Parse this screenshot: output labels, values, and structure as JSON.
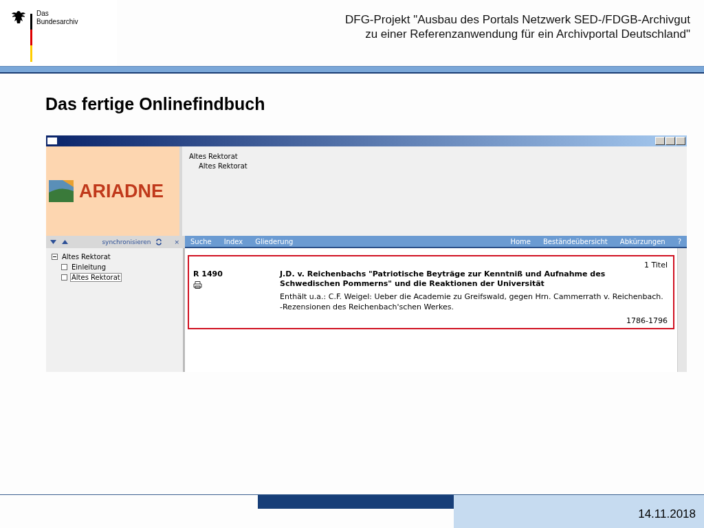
{
  "header": {
    "logo_lines": [
      "Das",
      "Bundesarchiv"
    ],
    "title_lines": [
      "DFG-Projekt \"Ausbau des Portals Netzwerk SED-/FDGB-Archivgut",
      "zu einer Referenzanwendung für ein Archivportal Deutschland\""
    ]
  },
  "heading": "Das fertige Onlinefindbuch",
  "app": {
    "logo": "ARIADNE",
    "breadcrumb": [
      "Altes Rektorat",
      "Altes Rektorat"
    ],
    "tree_toolbar": {
      "sync": "synchronisieren",
      "close": "×"
    },
    "tree": [
      {
        "label": "Altes Rektorat",
        "expanded": true,
        "selected": false,
        "children": [
          {
            "label": "Einleitung",
            "selected": false
          },
          {
            "label": "Altes Rektorat",
            "selected": true
          }
        ]
      }
    ],
    "nav_left": [
      "Suche",
      "Index",
      "Gliederung"
    ],
    "nav_right": [
      "Home",
      "Beständeübersicht",
      "Abkürzungen",
      "?"
    ],
    "result": {
      "count": "1 Titel",
      "signature": "R 1490",
      "title": "J.D. v. Reichenbachs \"Patriotische Beyträge zur Kenntniß und Aufnahme des Schwedischen Pommerns\" und die Reaktionen der Universität",
      "note": "Enthält u.a.: C.F. Weigel: Ueber die Academie zu Greifswald, gegen Hrn. Cammerrath v. Reichenbach. -Rezensionen des Reichenbach'schen Werkes.",
      "dates": "1786-1796"
    }
  },
  "footer": {
    "date": "14.11.2018"
  }
}
